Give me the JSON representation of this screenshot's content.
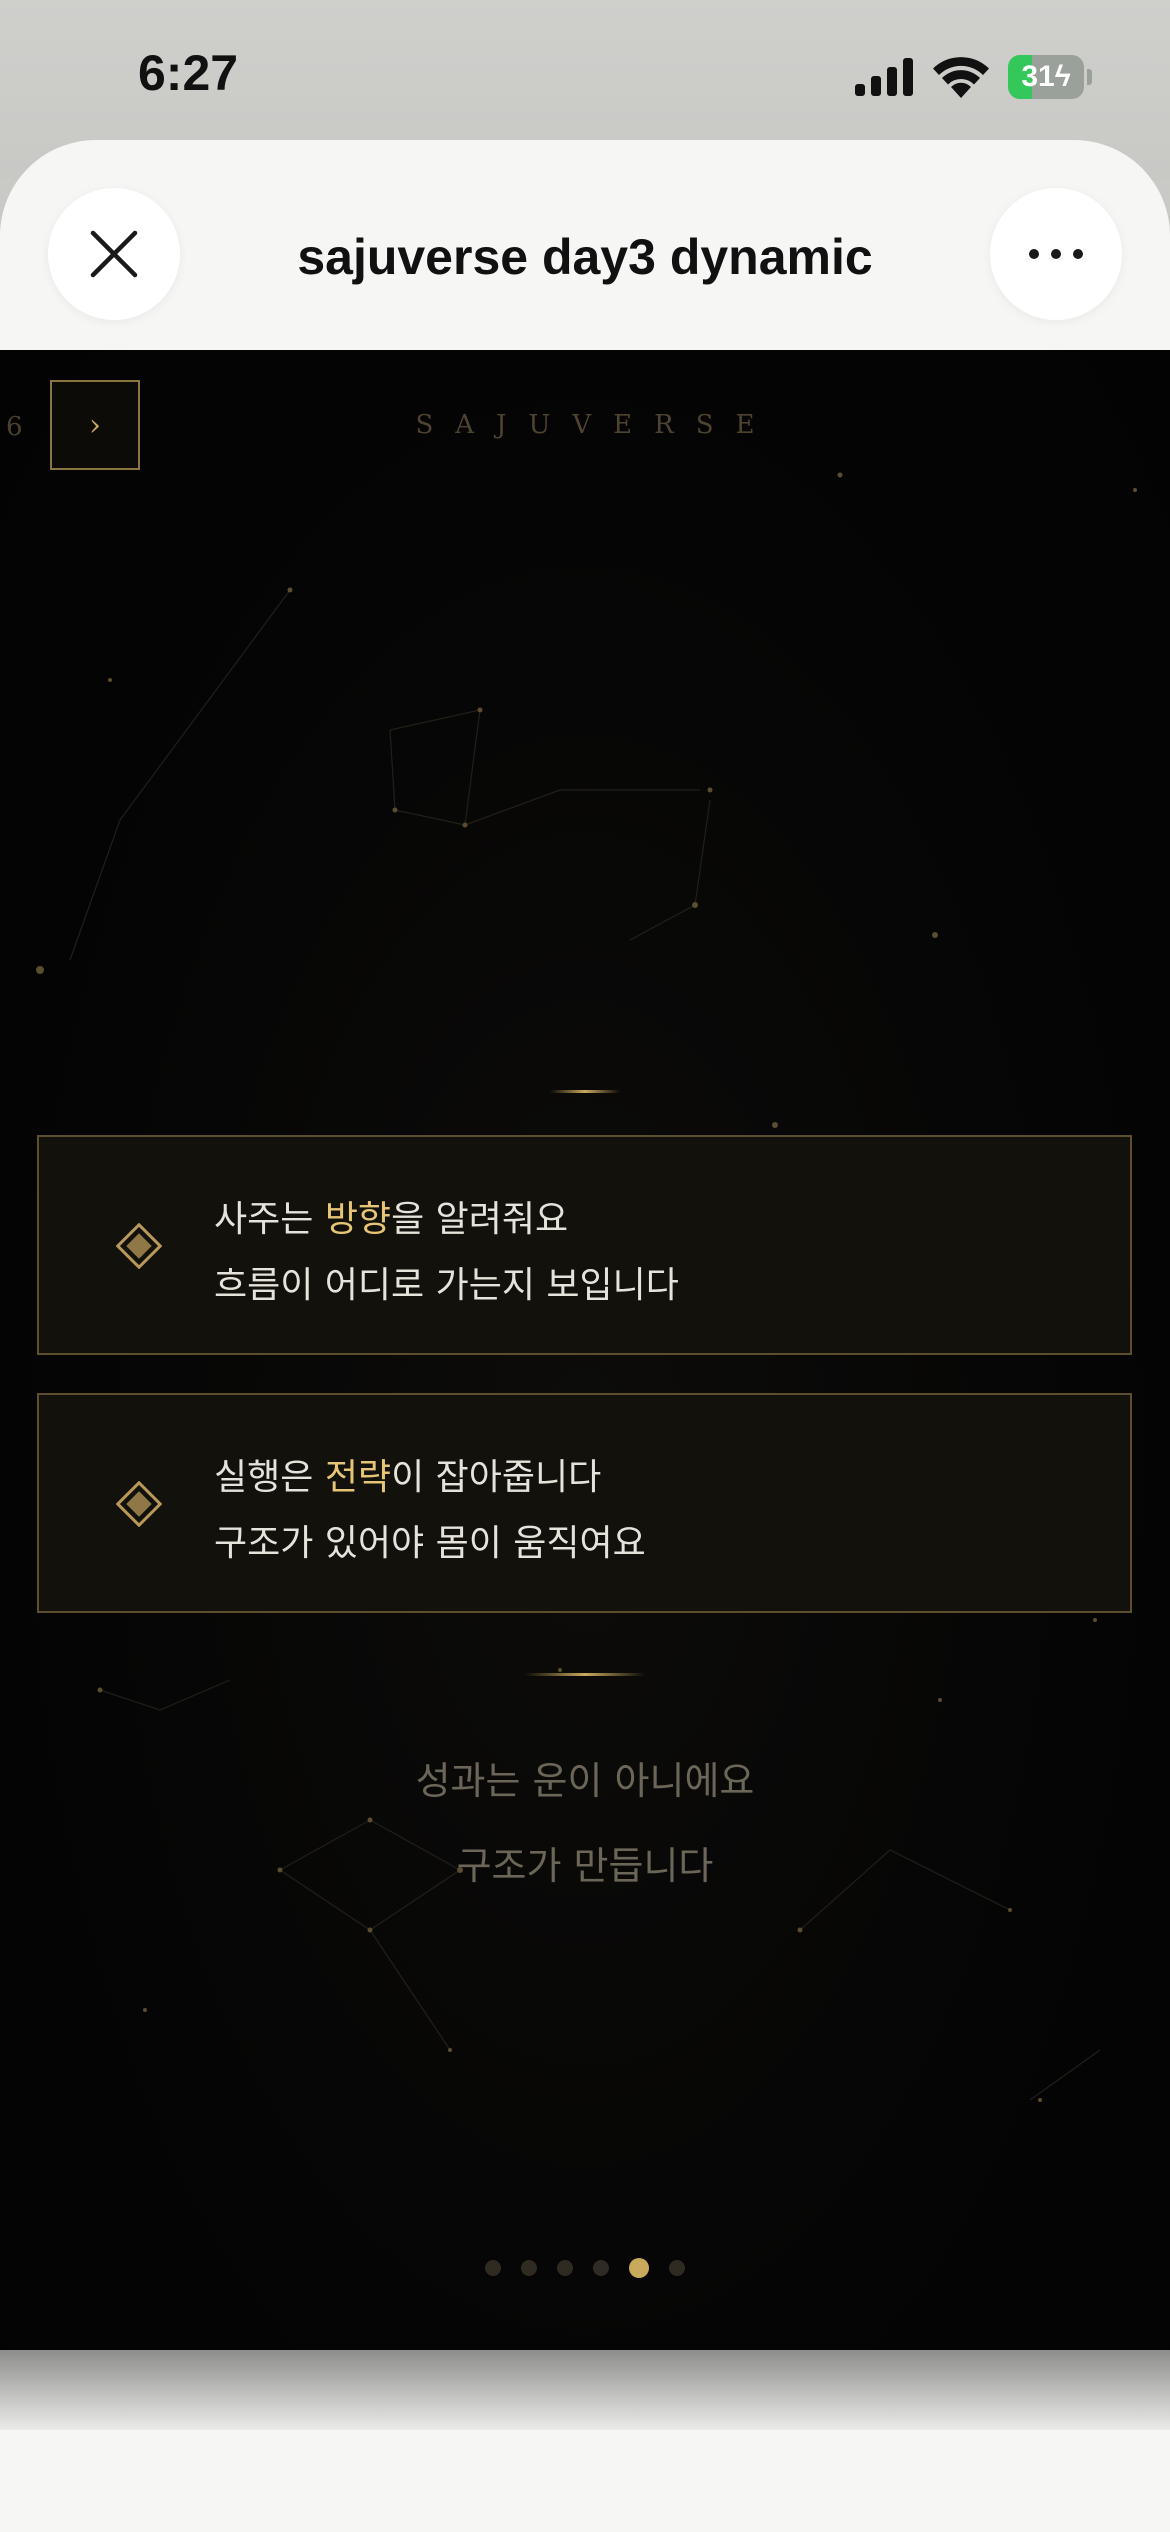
{
  "status_bar": {
    "time": "6:27",
    "battery_percent": 31,
    "battery_label": "31",
    "icons": [
      "cellular-signal-icon",
      "wifi-icon",
      "battery-charging-icon"
    ]
  },
  "background_page": {
    "faded_heading": "",
    "faded_line": ""
  },
  "sheet": {
    "title": "sajuverse day3 dynamic",
    "close_icon": "close-icon",
    "more_icon": "more-horizontal-icon"
  },
  "app": {
    "brand": "SAJUVERSE",
    "page_number": "6",
    "next_label": "›",
    "cards": [
      {
        "line1_prefix": "사주는 ",
        "line1_highlight": "방향",
        "line1_suffix": "을 알려줘요",
        "line2": "흐름이 어디로 가는지 보입니다"
      },
      {
        "line1_prefix": "실행은 ",
        "line1_highlight": "전략",
        "line1_suffix": "이 잡아줍니다",
        "line2": "구조가 있어야 몸이 움직여요"
      }
    ],
    "quote_line1": "성과는 운이 아니에요",
    "quote_line2": "구조가 만듭니다",
    "pagination": {
      "total": 6,
      "current": 5
    },
    "colors": {
      "gold": "#c9a95c",
      "highlight": "#e6c576",
      "background": "#050505"
    }
  }
}
